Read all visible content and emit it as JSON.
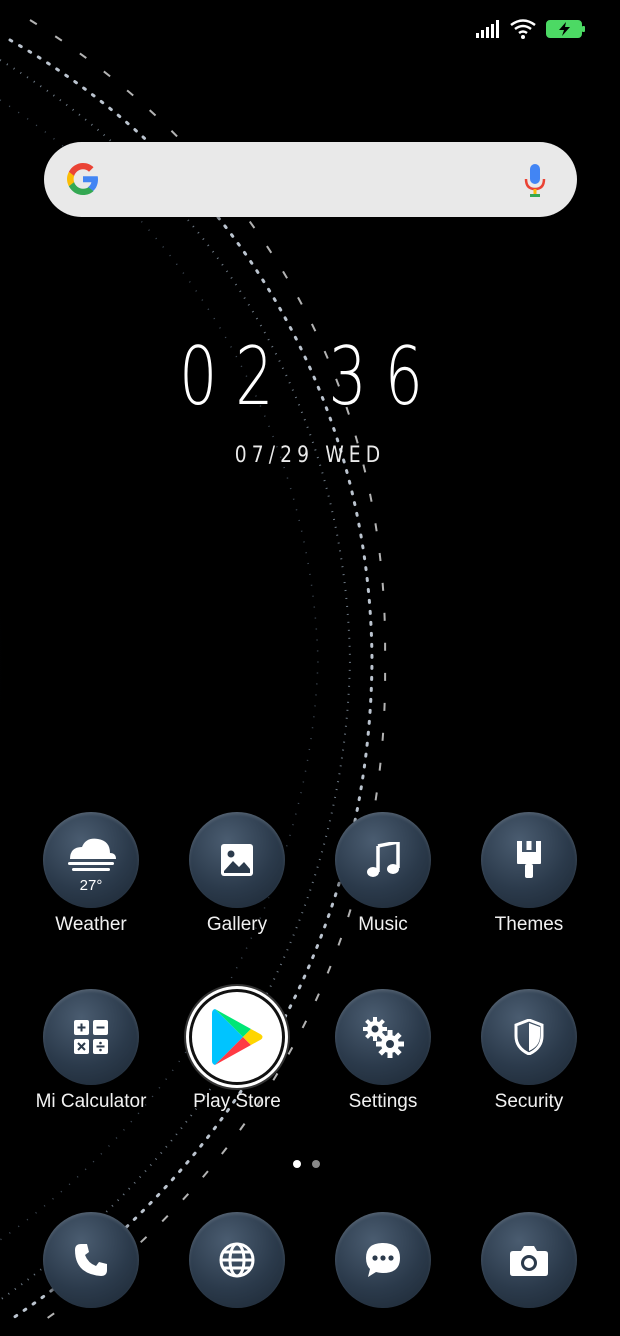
{
  "status_bar": {
    "battery": "charging"
  },
  "search_bar": {
    "logo": "google-logo",
    "mic": "microphone-icon"
  },
  "clock": {
    "time": "02 36",
    "date": "07/29 WED"
  },
  "weather": {
    "temperature": "27°"
  },
  "apps_row1": [
    {
      "label": "Weather",
      "icon": "cloud-icon"
    },
    {
      "label": "Gallery",
      "icon": "image-icon"
    },
    {
      "label": "Music",
      "icon": "music-note-icon"
    },
    {
      "label": "Themes",
      "icon": "brush-icon"
    }
  ],
  "apps_row2": [
    {
      "label": "Mi Calculator",
      "icon": "calculator-icon"
    },
    {
      "label": "Play Store",
      "icon": "play-store-icon"
    },
    {
      "label": "Settings",
      "icon": "gears-icon"
    },
    {
      "label": "Security",
      "icon": "shield-icon"
    }
  ],
  "dock": [
    {
      "icon": "phone-icon"
    },
    {
      "icon": "globe-icon"
    },
    {
      "icon": "chat-icon"
    },
    {
      "icon": "camera-icon"
    }
  ],
  "page_indicator": {
    "pages": 2,
    "current": 1
  },
  "colors": {
    "bubble": "#2b3a4b",
    "background": "#000000",
    "search_bg": "#e9e9e9"
  }
}
